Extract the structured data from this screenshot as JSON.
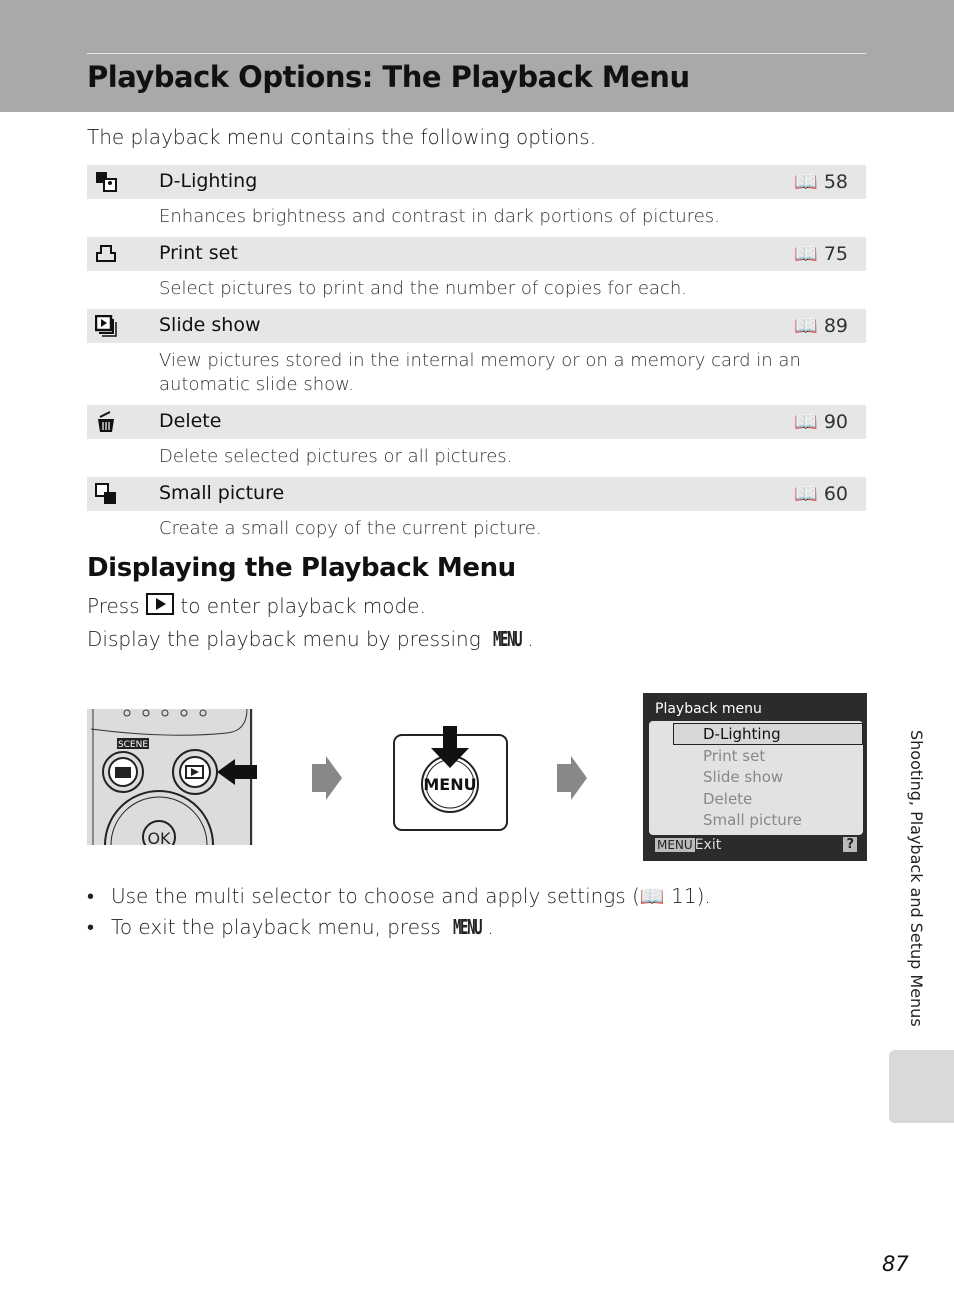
{
  "header": {
    "title": "Playback Options: The Playback Menu"
  },
  "intro": "The playback menu contains the following options.",
  "options": [
    {
      "icon": "d-lighting-icon",
      "label": "D-Lighting",
      "page": "58",
      "desc": "Enhances brightness and contrast in dark portions of pictures."
    },
    {
      "icon": "print-set-icon",
      "label": "Print set",
      "page": "75",
      "desc": "Select pictures to print and the number of copies for each."
    },
    {
      "icon": "slide-show-icon",
      "label": "Slide show",
      "page": "89",
      "desc": "View pictures stored in the internal memory or on a memory card in an automatic slide show."
    },
    {
      "icon": "delete-icon",
      "label": "Delete",
      "page": "90",
      "desc": "Delete selected pictures or all pictures."
    },
    {
      "icon": "small-picture-icon",
      "label": "Small picture",
      "page": "60",
      "desc": "Create a small copy of the current picture."
    }
  ],
  "section": {
    "title": "Displaying the Playback Menu",
    "line1_a": "Press",
    "line1_b": "to enter playback mode.",
    "line2": "Display the playback menu by pressing",
    "menu_word": "MENU",
    "period": "."
  },
  "illustration": {
    "scene_label": "SCENE",
    "menu_button": "MENU",
    "ok": "OK"
  },
  "lcd": {
    "title": "Playback menu",
    "items": [
      "D-Lighting",
      "Print set",
      "Slide show",
      "Delete",
      "Small picture"
    ],
    "footer_key": "MENU",
    "footer": "Exit",
    "help": "?"
  },
  "bullets": [
    {
      "text": "Use the multi selector to choose and apply settings (",
      "ref": "11",
      "end": ")."
    },
    {
      "text": "To exit the playback menu, press",
      "key": "MENU",
      "end": "."
    }
  ],
  "side_tab": "Shooting, Playback and Setup Menus",
  "page_number": "87"
}
